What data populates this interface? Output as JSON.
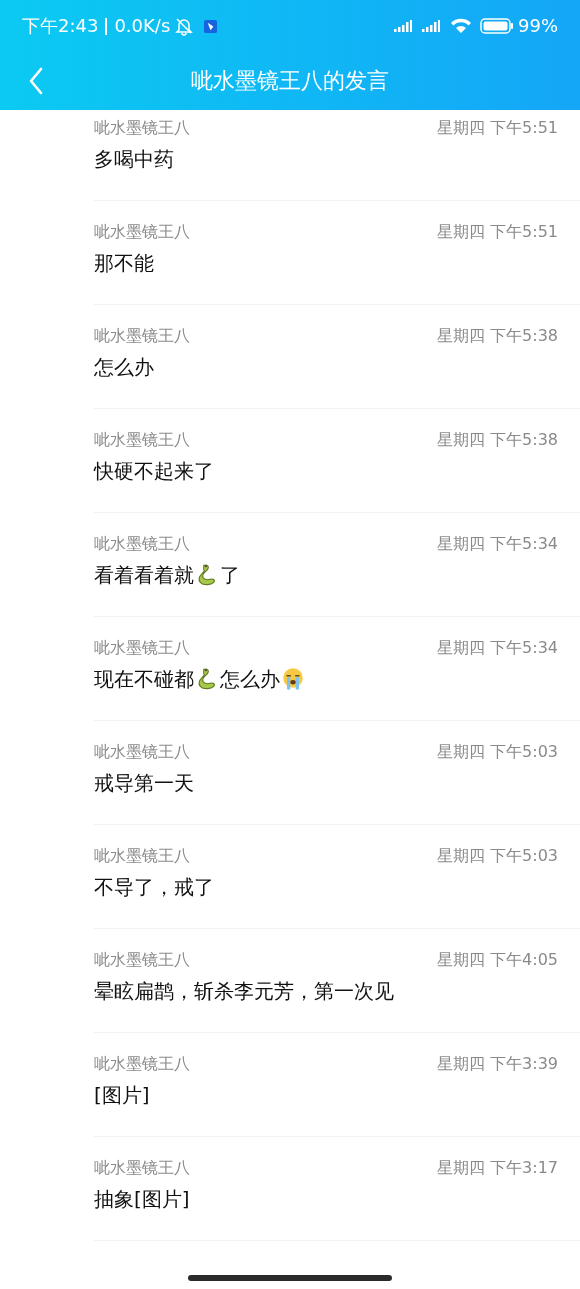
{
  "status_bar": {
    "time": "下午2:43",
    "speed": "0.0K/s",
    "battery": "99%"
  },
  "header": {
    "title": "呲水墨镜王八的发言"
  },
  "messages": [
    {
      "sender": "呲水墨镜王八",
      "time": "星期四 下午5:51",
      "parts": [
        {
          "kind": "text",
          "text": "多喝中药"
        }
      ]
    },
    {
      "sender": "呲水墨镜王八",
      "time": "星期四 下午5:51",
      "parts": [
        {
          "kind": "text",
          "text": "那不能"
        }
      ]
    },
    {
      "sender": "呲水墨镜王八",
      "time": "星期四 下午5:38",
      "parts": [
        {
          "kind": "text",
          "text": "怎么办"
        }
      ]
    },
    {
      "sender": "呲水墨镜王八",
      "time": "星期四 下午5:38",
      "parts": [
        {
          "kind": "text",
          "text": "快硬不起来了"
        }
      ]
    },
    {
      "sender": "呲水墨镜王八",
      "time": "星期四 下午5:34",
      "parts": [
        {
          "kind": "text",
          "text": "看着看着就"
        },
        {
          "kind": "snake"
        },
        {
          "kind": "text",
          "text": "了"
        }
      ]
    },
    {
      "sender": "呲水墨镜王八",
      "time": "星期四 下午5:34",
      "parts": [
        {
          "kind": "text",
          "text": "现在不碰都"
        },
        {
          "kind": "snake"
        },
        {
          "kind": "text",
          "text": "怎么办"
        },
        {
          "kind": "crying"
        }
      ]
    },
    {
      "sender": "呲水墨镜王八",
      "time": "星期四 下午5:03",
      "parts": [
        {
          "kind": "text",
          "text": "戒导第一天"
        }
      ]
    },
    {
      "sender": "呲水墨镜王八",
      "time": "星期四 下午5:03",
      "parts": [
        {
          "kind": "text",
          "text": "不导了，戒了"
        }
      ]
    },
    {
      "sender": "呲水墨镜王八",
      "time": "星期四 下午4:05",
      "parts": [
        {
          "kind": "text",
          "text": "晕眩扁鹊，斩杀李元芳，第一次见"
        }
      ]
    },
    {
      "sender": "呲水墨镜王八",
      "time": "星期四 下午3:39",
      "parts": [
        {
          "kind": "text",
          "text": "[图片]"
        }
      ]
    },
    {
      "sender": "呲水墨镜王八",
      "time": "星期四 下午3:17",
      "parts": [
        {
          "kind": "text",
          "text": "抽象[图片]"
        }
      ]
    }
  ]
}
